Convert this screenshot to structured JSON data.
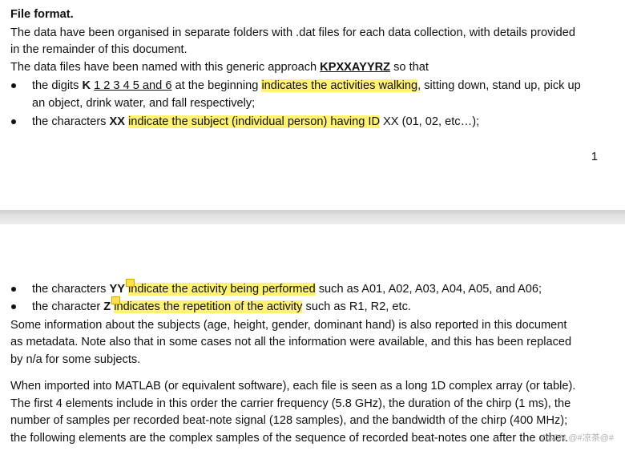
{
  "page1": {
    "heading": "File format.",
    "para1_line1": "The data have been organised in separate folders with .dat files for each data collection, with details provided",
    "para1_line2": "in the remainder of this document.",
    "para2_pre": "The data files have been named with this generic approach ",
    "para2_code": "KPXXAYYRZ",
    "para2_post": " so that",
    "bullet1_pre": "the digits ",
    "bullet1_k": "K",
    "bullet1_digits": "1 2 3 4 5 and 6",
    "bullet1_mid": " at the beginning ",
    "bullet1_hl": "indicates the activities walking",
    "bullet1_post": ", sitting down, stand up, pick up",
    "bullet1_line2": "an object, drink water, and fall respectively;",
    "bullet2_pre": "the characters ",
    "bullet2_code": "XX",
    "bullet2_hl": "indicate the subject (individual person) having ID",
    "bullet2_post": " XX (01, 02, etc…);",
    "page_number": "1"
  },
  "page2": {
    "bullet3_pre": "the characters ",
    "bullet3_code": "YY",
    "bullet3_hl": "indicate the activity being performed",
    "bullet3_post": " such as A01, A02, A03, A04, A05, and A06;",
    "bullet4_pre": "the character ",
    "bullet4_code": "Z",
    "bullet4_hl": "indicates the repetition of the activity",
    "bullet4_post": " such as R1, R2, etc.",
    "para3_line1": "Some information about the subjects (age, height, gender, dominant hand) is also reported in this document",
    "para3_line2": "as metadata. Note also that in some cases not all the information were available, and this has been replaced",
    "para3_line3": "by n/a for some subjects.",
    "para4_line1": "When imported into MATLAB (or equivalent software), each file is seen as a long 1D complex array (or table).",
    "para4_line2": "The first 4 elements include in this order the carrier frequency (5.8 GHz), the duration of the chirp (1 ms), the",
    "para4_line3": "number of samples per recorded beat-note signal (128 samples), and the bandwidth of the chirp (400 MHz);",
    "para4_line4": "the following elements are the complex samples of the sequence of recorded beat-notes one after the other.",
    "watermark": "CSDN @#凉茶@#"
  },
  "colors": {
    "highlight": "#fff275",
    "comment_icon": "#ffe14d"
  }
}
